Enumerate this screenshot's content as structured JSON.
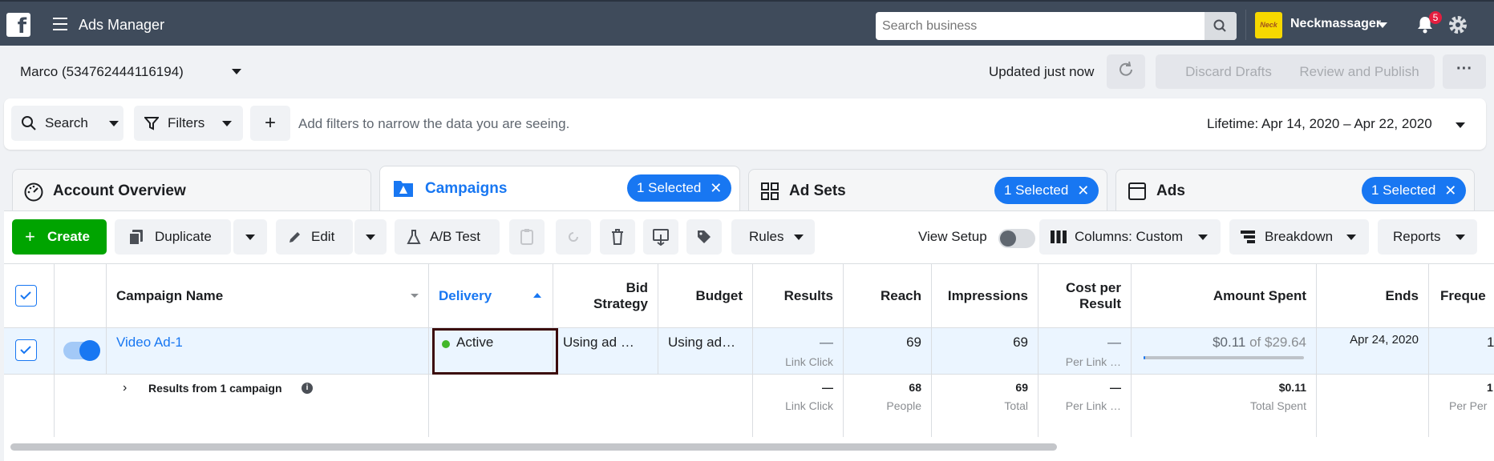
{
  "topbar": {
    "logo": "f",
    "app_title": "Ads Manager",
    "search_placeholder": "Search business",
    "business_name": "Neckmassager",
    "business_logo_text": "Neck",
    "notification_count": "5"
  },
  "account": {
    "name": "Marco (534762444116194)",
    "updated": "Updated just now",
    "discard_label": "Discard Drafts",
    "review_label": "Review and Publish",
    "more_label": "···"
  },
  "filters": {
    "search_label": "Search",
    "filters_label": "Filters",
    "add_label": "+",
    "hint": "Add filters to narrow the data you are seeing.",
    "date_range": "Lifetime: Apr 14, 2020 – Apr 22, 2020"
  },
  "tabs": [
    {
      "label": "Account Overview"
    },
    {
      "label": "Campaigns",
      "selected": "1 Selected"
    },
    {
      "label": "Ad Sets",
      "selected": "1 Selected"
    },
    {
      "label": "Ads",
      "selected": "1 Selected"
    }
  ],
  "toolbar": {
    "create_label": "Create",
    "duplicate_label": "Duplicate",
    "edit_label": "Edit",
    "ab_test_label": "A/B Test",
    "rules_label": "Rules",
    "view_setup_label": "View Setup",
    "columns_label": "Columns: Custom",
    "breakdown_label": "Breakdown",
    "reports_label": "Reports"
  },
  "table": {
    "headers": {
      "name": "Campaign Name",
      "delivery": "Delivery",
      "bid_strategy": "Bid Strategy",
      "budget": "Budget",
      "results": "Results",
      "reach": "Reach",
      "impressions": "Impressions",
      "cost_per_result": "Cost per Result",
      "amount_spent": "Amount Spent",
      "ends": "Ends",
      "frequency": "Freque"
    },
    "row": {
      "name": "Video Ad-1",
      "delivery": "Active",
      "bid_strategy": "Using ad …",
      "budget": "Using ad…",
      "results": "—",
      "results_sub": "Link Click",
      "reach": "69",
      "impressions": "69",
      "cost_per_result": "—",
      "cost_per_result_sub": "Per Link …",
      "amount_spent": "$0.11",
      "amount_spent_of": "of $29.64",
      "amount_spent_fraction": 0.004,
      "ends": "Apr 24, 2020",
      "frequency": "1"
    },
    "summary": {
      "label": "Results from 1 campaign",
      "results": "—",
      "results_sub": "Link Click",
      "reach": "68",
      "reach_sub": "People",
      "impressions": "69",
      "impressions_sub": "Total",
      "cost_per_result": "—",
      "cost_per_result_sub": "Per Link …",
      "amount_spent": "$0.11",
      "amount_spent_sub": "Total Spent",
      "frequency": "1",
      "frequency_sub": "Per Per"
    }
  },
  "colors": {
    "topbar": "#3f4b5b",
    "accent": "#1877f2",
    "create": "#00a400",
    "active_dot": "#42b72a",
    "highlight_border": "#3b0a0a"
  }
}
